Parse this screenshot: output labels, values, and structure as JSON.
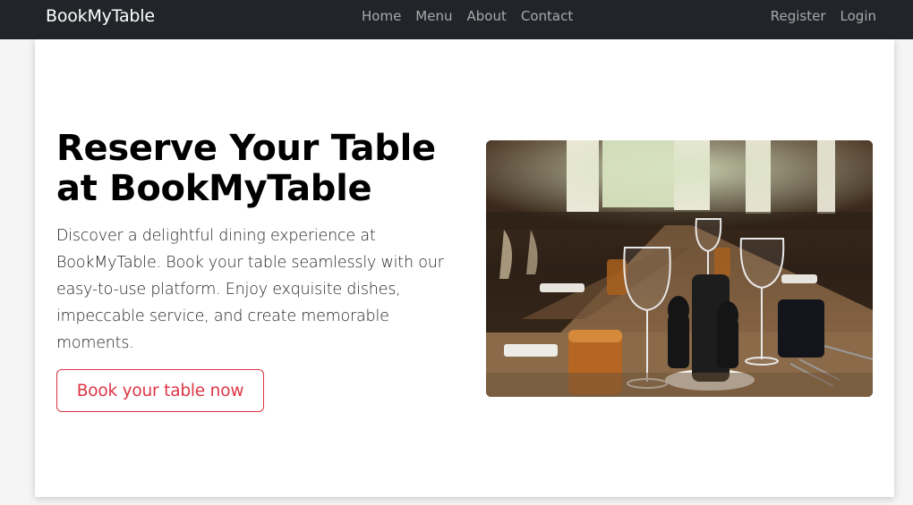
{
  "brand": "BookMyTable",
  "nav": {
    "items": [
      {
        "label": "Home"
      },
      {
        "label": "Menu"
      },
      {
        "label": "About"
      },
      {
        "label": "Contact"
      }
    ],
    "right": [
      {
        "label": "Register"
      },
      {
        "label": "Login"
      }
    ]
  },
  "hero": {
    "title": "Reserve Your Table at BookMyTable",
    "description": "Discover a delightful dining experience at BookMyTable. Book your table seamlessly with our easy-to-use platform. Enjoy exquisite dishes, impeccable service, and create memorable moments.",
    "cta_label": "Book your table now"
  },
  "colors": {
    "navbar_bg": "#212529",
    "accent": "#dc3545"
  }
}
